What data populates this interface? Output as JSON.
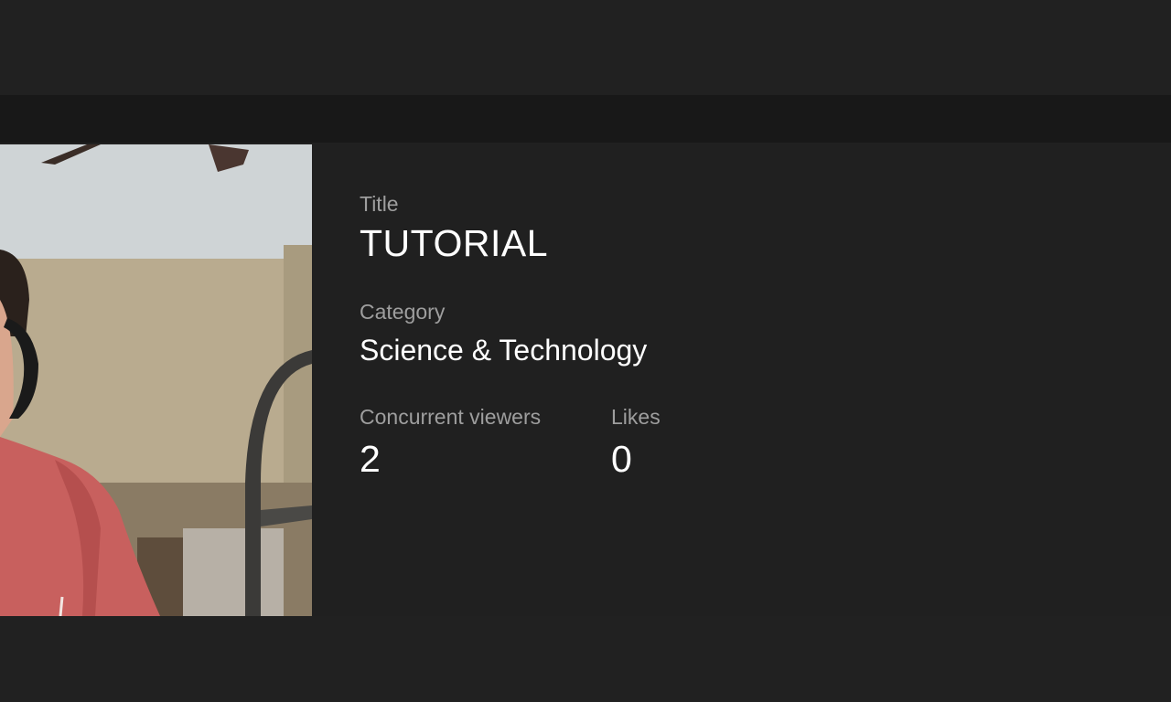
{
  "stream_info": {
    "title_label": "Title",
    "title_value": "TUTORIAL",
    "category_label": "Category",
    "category_value": "Science & Technology",
    "viewers_label": "Concurrent viewers",
    "viewers_value": "2",
    "likes_label": "Likes",
    "likes_value": "0"
  },
  "colors": {
    "background": "#212121",
    "strip": "#181818",
    "label_text": "#9e9e9e",
    "value_text": "#ffffff"
  }
}
